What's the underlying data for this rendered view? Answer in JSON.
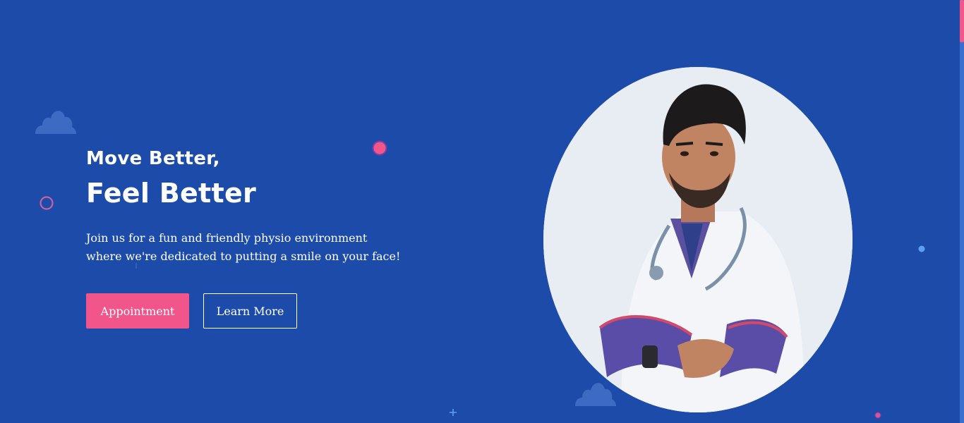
{
  "hero": {
    "headline_small": "Move Better,",
    "headline_big": "Feel Better",
    "description": "Join us for a fun and friendly physio environment where we're dedicated to putting a smile on your face!",
    "appointment_label": "Appointment",
    "learn_more_label": "Learn More"
  },
  "colors": {
    "background": "#1c4baa",
    "accent_pink": "#f2558a",
    "button_text": "#ffffff"
  },
  "icons": {
    "cloud": "cloud-icon",
    "ring": "circle-icon",
    "dot": "dot-icon",
    "plus": "plus-icon"
  }
}
